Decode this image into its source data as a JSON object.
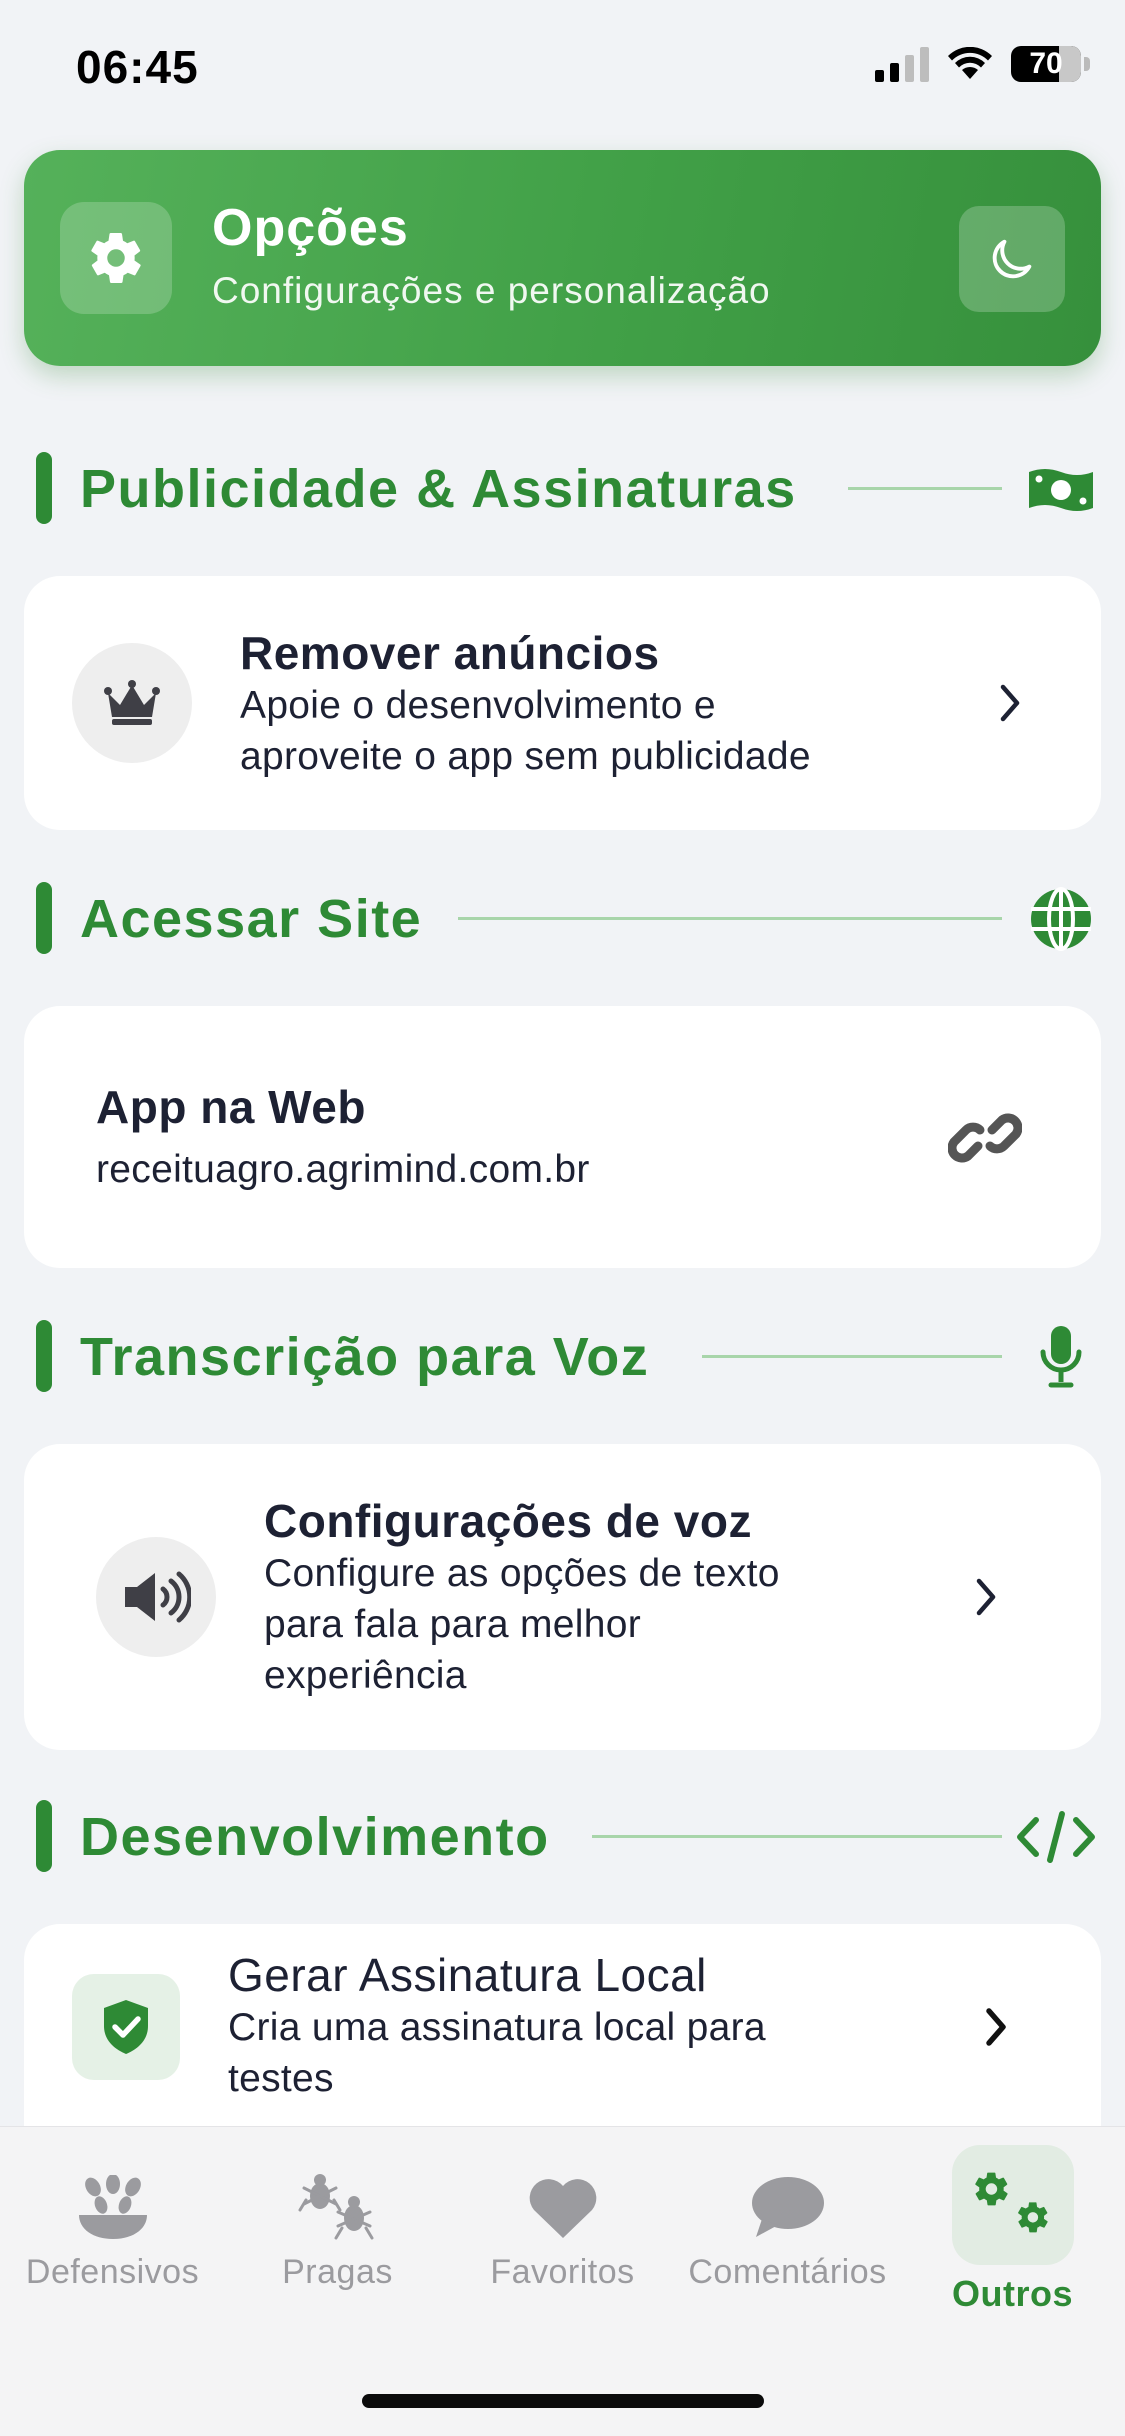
{
  "status": {
    "time": "06:45",
    "battery": "70"
  },
  "header": {
    "title": "Opções",
    "subtitle": "Configurações e personalização"
  },
  "sections": {
    "ads": {
      "title": "Publicidade & Assinaturas",
      "item_title": "Remover anúncios",
      "item_desc_1": "Apoie o desenvolvimento e",
      "item_desc_2": "aproveite o app sem publicidade"
    },
    "site": {
      "title": "Acessar Site",
      "item_title": "App na Web",
      "item_desc": "receituagro.agrimind.com.br"
    },
    "voice": {
      "title": "Transcrição para Voz",
      "item_title": "Configurações de voz",
      "item_desc_1": "Configure as opções de texto",
      "item_desc_2": "para fala para melhor",
      "item_desc_3": "experiência"
    },
    "dev": {
      "title": "Desenvolvimento",
      "item_title": "Gerar Assinatura Local",
      "item_desc_1": "Cria uma assinatura local para",
      "item_desc_2": "testes"
    }
  },
  "nav": {
    "items": [
      {
        "label": "Defensivos",
        "icon": "seedling-bowl-icon"
      },
      {
        "label": "Pragas",
        "icon": "bugs-icon"
      },
      {
        "label": "Favoritos",
        "icon": "heart-icon"
      },
      {
        "label": "Comentários",
        "icon": "comment-icon"
      },
      {
        "label": "Outros",
        "icon": "gears-icon"
      }
    ],
    "active": "Outros"
  },
  "colors": {
    "accent": "#2e8a35",
    "header_gradient_start": "#55b15a",
    "header_gradient_end": "#36903c",
    "background": "#f1f3f6",
    "nav_inactive": "#9b9b9f"
  }
}
